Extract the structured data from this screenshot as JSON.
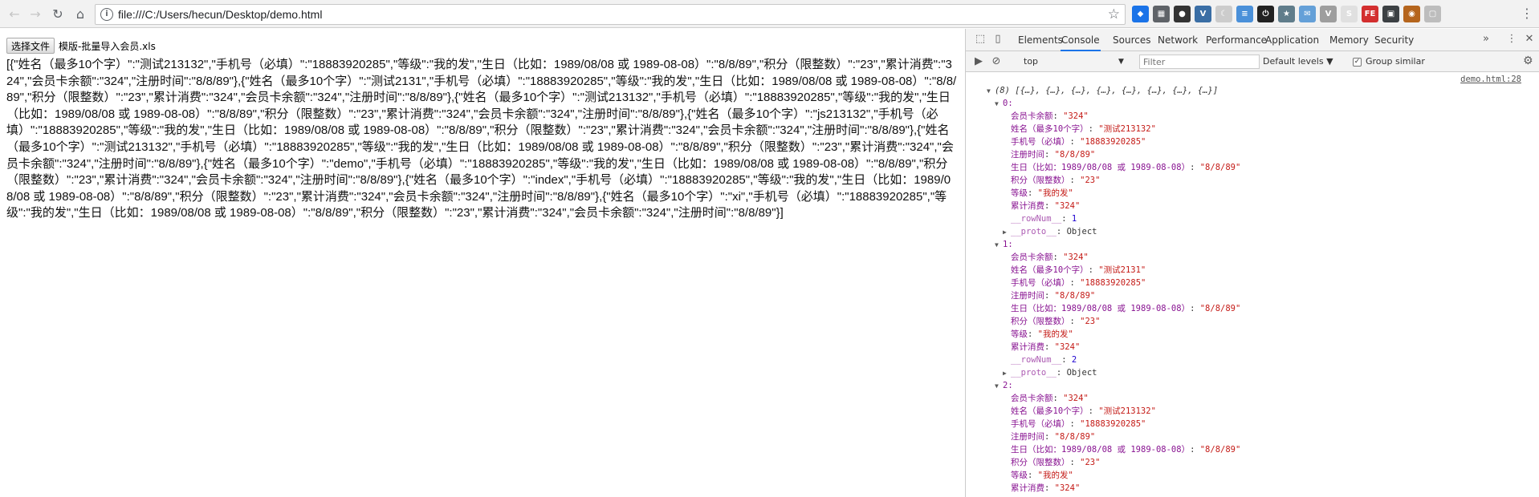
{
  "browser": {
    "url": "file:///C:/Users/hecun/Desktop/demo.html",
    "extensions": [
      {
        "icon": "ext-blue-icon",
        "color": "#1a73e8",
        "glyph": "◆"
      },
      {
        "icon": "qr-icon",
        "color": "#5f6368",
        "glyph": "▦"
      },
      {
        "icon": "dark-circle-icon",
        "color": "#333333",
        "glyph": "●"
      },
      {
        "icon": "vue-icon",
        "color": "#3a6ea5",
        "glyph": "V"
      },
      {
        "icon": "moon-icon",
        "color": "#cccccc",
        "glyph": "☾"
      },
      {
        "icon": "note-icon",
        "color": "#4a90d9",
        "glyph": "≡"
      },
      {
        "icon": "power-icon",
        "color": "#222222",
        "glyph": "⏻"
      },
      {
        "icon": "puzzle-icon",
        "color": "#607d8b",
        "glyph": "★"
      },
      {
        "icon": "mail-icon",
        "color": "#64a0d8",
        "glyph": "✉"
      },
      {
        "icon": "vuetools-icon",
        "color": "#9e9e9e",
        "glyph": "V"
      },
      {
        "icon": "s-icon",
        "color": "#e0e0e0",
        "glyph": "S"
      },
      {
        "icon": "fe-icon",
        "color": "#d32f2f",
        "glyph": "FE"
      },
      {
        "icon": "grid-icon",
        "color": "#3c4043",
        "glyph": "▣"
      },
      {
        "icon": "cookie-icon",
        "color": "#b5651d",
        "glyph": "◉"
      },
      {
        "icon": "gray-icon",
        "color": "#bdbdbd",
        "glyph": "▢"
      }
    ]
  },
  "page": {
    "choose_file_label": "选择文件",
    "file_name": "模版-批量导入会员.xls",
    "json_output": "[{\"姓名（最多10个字）\":\"测试213132\",\"手机号（必填）\":\"18883920285\",\"等级\":\"我的发\",\"生日（比如：1989/08/08 或 1989-08-08）\":\"8/8/89\",\"积分（限整数）\":\"23\",\"累计消费\":\"324\",\"会员卡余额\":\"324\",\"注册时间\":\"8/8/89\"},{\"姓名（最多10个字）\":\"测试2131\",\"手机号（必填）\":\"18883920285\",\"等级\":\"我的发\",\"生日（比如：1989/08/08 或 1989-08-08）\":\"8/8/89\",\"积分（限整数）\":\"23\",\"累计消费\":\"324\",\"会员卡余额\":\"324\",\"注册时间\":\"8/8/89\"},{\"姓名（最多10个字）\":\"测试213132\",\"手机号（必填）\":\"18883920285\",\"等级\":\"我的发\",\"生日（比如：1989/08/08 或 1989-08-08）\":\"8/8/89\",\"积分（限整数）\":\"23\",\"累计消费\":\"324\",\"会员卡余额\":\"324\",\"注册时间\":\"8/8/89\"},{\"姓名（最多10个字）\":\"js213132\",\"手机号（必填）\":\"18883920285\",\"等级\":\"我的发\",\"生日（比如：1989/08/08 或 1989-08-08）\":\"8/8/89\",\"积分（限整数）\":\"23\",\"累计消费\":\"324\",\"会员卡余额\":\"324\",\"注册时间\":\"8/8/89\"},{\"姓名（最多10个字）\":\"测试213132\",\"手机号（必填）\":\"18883920285\",\"等级\":\"我的发\",\"生日（比如：1989/08/08 或 1989-08-08）\":\"8/8/89\",\"积分（限整数）\":\"23\",\"累计消费\":\"324\",\"会员卡余额\":\"324\",\"注册时间\":\"8/8/89\"},{\"姓名（最多10个字）\":\"demo\",\"手机号（必填）\":\"18883920285\",\"等级\":\"我的发\",\"生日（比如：1989/08/08 或 1989-08-08）\":\"8/8/89\",\"积分（限整数）\":\"23\",\"累计消费\":\"324\",\"会员卡余额\":\"324\",\"注册时间\":\"8/8/89\"},{\"姓名（最多10个字）\":\"index\",\"手机号（必填）\":\"18883920285\",\"等级\":\"我的发\",\"生日（比如：1989/08/08 或 1989-08-08）\":\"8/8/89\",\"积分（限整数）\":\"23\",\"累计消费\":\"324\",\"会员卡余额\":\"324\",\"注册时间\":\"8/8/89\"},{\"姓名（最多10个字）\":\"xi\",\"手机号（必填）\":\"18883920285\",\"等级\":\"我的发\",\"生日（比如：1989/08/08 或 1989-08-08）\":\"8/8/89\",\"积分（限整数）\":\"23\",\"累计消费\":\"324\",\"会员卡余额\":\"324\",\"注册时间\":\"8/8/89\"}]"
  },
  "devtools": {
    "tabs": [
      "Elements",
      "Console",
      "Sources",
      "Network",
      "Performance",
      "Application",
      "Memory",
      "Security"
    ],
    "active_tab": "Console",
    "more_tabs": "»",
    "context": "top",
    "filter_placeholder": "Filter",
    "levels_label": "Default levels ▼",
    "group_similar_label": "Group similar",
    "source_link": "demo.html:28",
    "log_header": "(8) [{…}, {…}, {…}, {…}, {…}, {…}, {…}, {…}]",
    "entries": [
      {
        "index": "0:",
        "props": [
          {
            "key": "会员卡余额",
            "value": "\"324\""
          },
          {
            "key": "姓名（最多10个字）",
            "value": "\"测试213132\""
          },
          {
            "key": "手机号（必填）",
            "value": "\"18883920285\""
          },
          {
            "key": "注册时间",
            "value": "\"8/8/89\""
          },
          {
            "key": "生日（比如：1989/08/08 或 1989-08-08）",
            "value": "\"8/8/89\""
          },
          {
            "key": "积分（限整数）",
            "value": "\"23\""
          },
          {
            "key": "等级",
            "value": "\"我的发\""
          },
          {
            "key": "累计消费",
            "value": "\"324\""
          }
        ],
        "row_num_key": "__rowNum__",
        "row_num": "1",
        "proto_key": "__proto__",
        "proto_value": "Object"
      },
      {
        "index": "1:",
        "props": [
          {
            "key": "会员卡余额",
            "value": "\"324\""
          },
          {
            "key": "姓名（最多10个字）",
            "value": "\"测试2131\""
          },
          {
            "key": "手机号（必填）",
            "value": "\"18883920285\""
          },
          {
            "key": "注册时间",
            "value": "\"8/8/89\""
          },
          {
            "key": "生日（比如：1989/08/08 或 1989-08-08）",
            "value": "\"8/8/89\""
          },
          {
            "key": "积分（限整数）",
            "value": "\"23\""
          },
          {
            "key": "等级",
            "value": "\"我的发\""
          },
          {
            "key": "累计消费",
            "value": "\"324\""
          }
        ],
        "row_num_key": "__rowNum__",
        "row_num": "2",
        "proto_key": "__proto__",
        "proto_value": "Object"
      },
      {
        "index": "2:",
        "props": [
          {
            "key": "会员卡余额",
            "value": "\"324\""
          },
          {
            "key": "姓名（最多10个字）",
            "value": "\"测试213132\""
          },
          {
            "key": "手机号（必填）",
            "value": "\"18883920285\""
          },
          {
            "key": "注册时间",
            "value": "\"8/8/89\""
          },
          {
            "key": "生日（比如：1989/08/08 或 1989-08-08）",
            "value": "\"8/8/89\""
          },
          {
            "key": "积分（限整数）",
            "value": "\"23\""
          },
          {
            "key": "等级",
            "value": "\"我的发\""
          },
          {
            "key": "累计消费",
            "value": "\"324\""
          }
        ]
      }
    ]
  }
}
